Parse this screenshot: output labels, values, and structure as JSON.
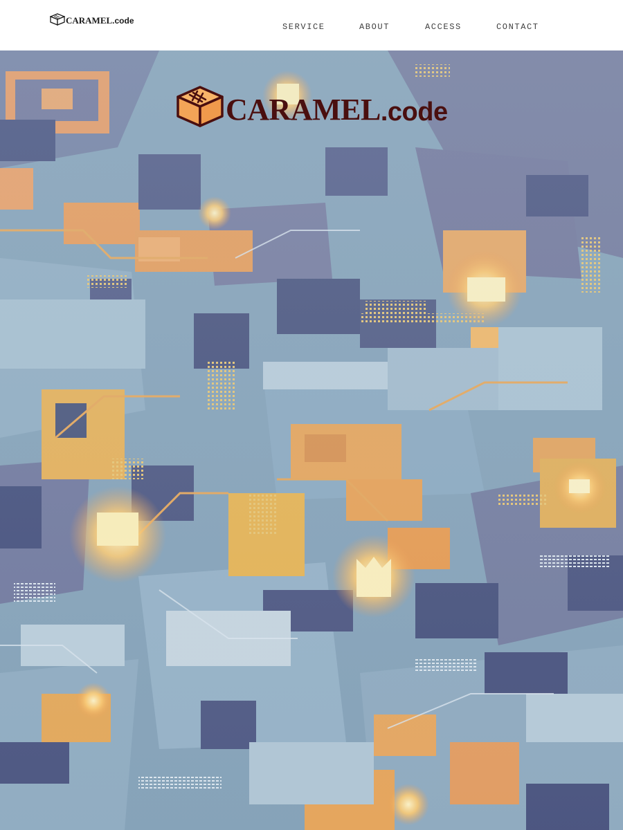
{
  "brand": {
    "name": "CARAMEL",
    "suffix": ".code"
  },
  "nav": {
    "items": [
      {
        "label": "SERVICE"
      },
      {
        "label": "ABOUT"
      },
      {
        "label": "ACCESS"
      },
      {
        "label": "CONTACT"
      }
    ]
  },
  "hero": {
    "logo_name": "CARAMEL",
    "logo_suffix": ".code",
    "logo_icon": "caramel-box-icon",
    "background": "circuit-city-illustration"
  },
  "colors": {
    "header_bg": "#ffffff",
    "nav_text": "#3d3d3d",
    "logo_text": "#4a0f0f",
    "logo_icon": "#f6a75a",
    "hero_tint": "#7d9bb3",
    "accent_glow": "#ffd77a"
  }
}
